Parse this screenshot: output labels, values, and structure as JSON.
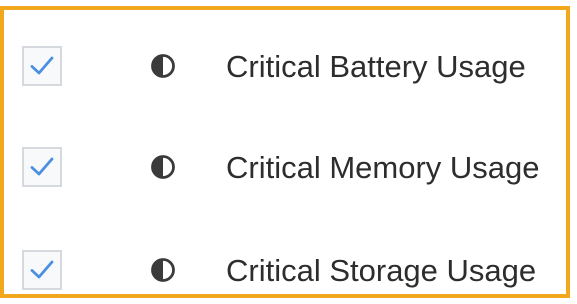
{
  "items": [
    {
      "label": "Critical Battery Usage",
      "checked": true,
      "icon": "half-circle-icon"
    },
    {
      "label": "Critical Memory Usage",
      "checked": true,
      "icon": "half-circle-icon"
    },
    {
      "label": "Critical Storage Usage",
      "checked": true,
      "icon": "half-circle-icon"
    }
  ],
  "colors": {
    "frame_border": "#f2a81d",
    "checkmark": "#4a90e2",
    "checkbox_border": "#d6d9dd",
    "icon": "#3b3b3b",
    "label_text": "#2d2d2d"
  }
}
